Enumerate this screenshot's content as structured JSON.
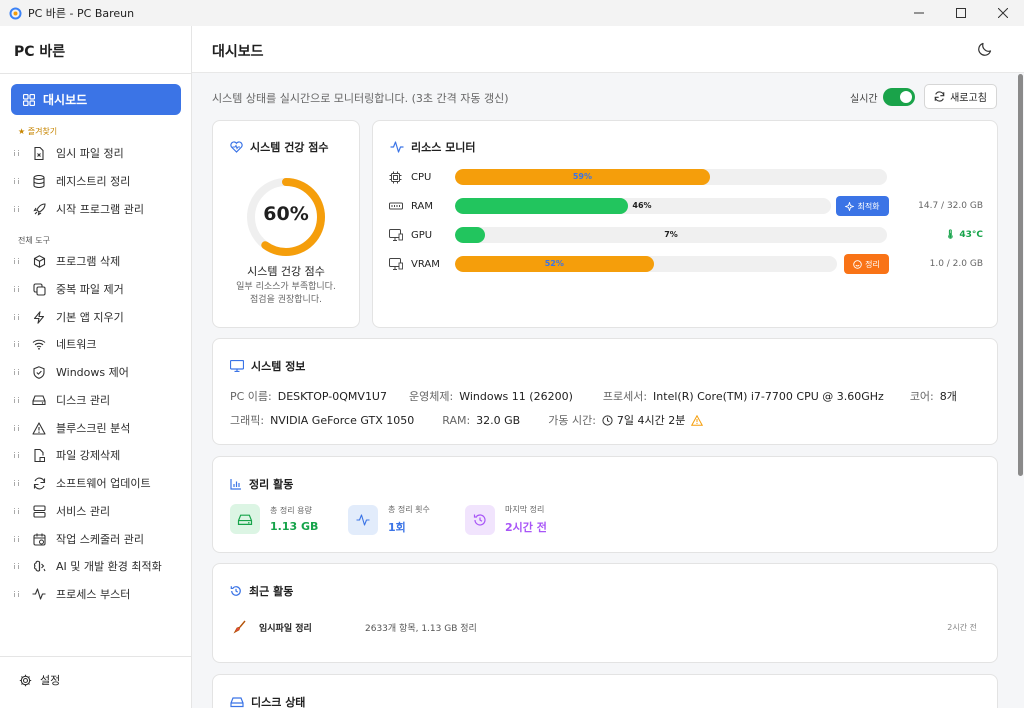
{
  "window": {
    "title": "PC 바른 - PC Bareun"
  },
  "sidebar": {
    "app_name": "PC 바른",
    "active_item": {
      "label": "대시보드",
      "icon": "grid-icon"
    },
    "favorites_label": "★ 즐겨찾기",
    "favorites": [
      {
        "label": "임시 파일 정리",
        "icon": "file-x-icon"
      },
      {
        "label": "레지스트리 정리",
        "icon": "database-icon"
      },
      {
        "label": "시작 프로그램 관리",
        "icon": "rocket-icon"
      }
    ],
    "all_tools_label": "전체 도구",
    "tools": [
      {
        "label": "프로그램 삭제",
        "icon": "package-icon"
      },
      {
        "label": "중복 파일 제거",
        "icon": "copy-icon"
      },
      {
        "label": "기본 앱 지우기",
        "icon": "lightning-icon"
      },
      {
        "label": "네트워크",
        "icon": "wifi-icon"
      },
      {
        "label": "Windows 제어",
        "icon": "shield-icon"
      },
      {
        "label": "디스크 관리",
        "icon": "drive-icon"
      },
      {
        "label": "블루스크린 분석",
        "icon": "warning-icon"
      },
      {
        "label": "파일 강제삭제",
        "icon": "file-lock-icon"
      },
      {
        "label": "소프트웨어 업데이트",
        "icon": "refresh-icon"
      },
      {
        "label": "서비스 관리",
        "icon": "server-icon"
      },
      {
        "label": "작업 스케줄러 관리",
        "icon": "calendar-icon"
      },
      {
        "label": "AI 및 개발 환경 최적화",
        "icon": "brain-icon"
      },
      {
        "label": "프로세스 부스터",
        "icon": "activity-icon"
      }
    ],
    "settings_label": "설정"
  },
  "header": {
    "title": "대시보드",
    "subtitle": "시스템 상태를 실시간으로 모니터링합니다. (3초 간격 자동 갱신)",
    "realtime_label": "실시간",
    "realtime_on": true,
    "refresh_label": "새로고침"
  },
  "health": {
    "title": "시스템 건강 점수",
    "score": 60,
    "score_text": "60%",
    "label": "시스템 건강 점수",
    "desc_line1": "일부 리소스가 부족합니다.",
    "desc_line2": "점검을 권장합니다.",
    "color": "#f59e0b"
  },
  "resources": {
    "title": "리소스 모니터",
    "rows": [
      {
        "name": "CPU",
        "percent": 59,
        "label": "59%",
        "color": "#f59e0b",
        "label_color": "#3b74e6",
        "right": "",
        "icon": "cpu-icon"
      },
      {
        "name": "RAM",
        "percent": 46,
        "label": "46%",
        "color": "#22c55e",
        "label_color": "#1f1f1f",
        "right": "14.7 / 32.0 GB",
        "icon": "memory-icon",
        "action": "최적화",
        "action_color": "#3b74e6"
      },
      {
        "name": "GPU",
        "percent": 7,
        "label": "7%",
        "color": "#22c55e",
        "label_color": "#1f1f1f",
        "right": "🌡 43°C",
        "right_color": "#16a34a",
        "icon": "monitor-icon"
      },
      {
        "name": "VRAM",
        "percent": 52,
        "label": "52%",
        "color": "#f59e0b",
        "label_color": "#3b74e6",
        "right": "1.0 / 2.0 GB",
        "icon": "monitor-icon",
        "action": "정리",
        "action_color": "#f97316"
      }
    ]
  },
  "system_info": {
    "title": "시스템 정보",
    "pc_name_k": "PC 이름:",
    "pc_name_v": "DESKTOP-0QMV1U7",
    "os_k": "운영체제:",
    "os_v": "Windows 11 (26200)",
    "cpu_k": "프로세서:",
    "cpu_v": "Intel(R) Core(TM) i7-7700 CPU @ 3.60GHz",
    "cores_k": "코어:",
    "cores_v": "8개",
    "gpu_k": "그래픽:",
    "gpu_v": "NVIDIA GeForce GTX 1050",
    "ram_k": "RAM:",
    "ram_v": "32.0 GB",
    "uptime_k": "가동 시간:",
    "uptime_v": "7일 4시간 2분"
  },
  "cleanup": {
    "title": "정리 활동",
    "total_size_k": "총 정리 용량",
    "total_size_v": "1.13 GB",
    "count_k": "총 정리 횟수",
    "count_v": "1회",
    "last_k": "마지막 정리",
    "last_v": "2시간 전",
    "colors": {
      "green": "#16a34a",
      "blue": "#3b74e6",
      "purple": "#a855f7"
    }
  },
  "recent": {
    "title": "최근 활동",
    "items": [
      {
        "name": "임시파일 정리",
        "detail": "2633개 항목, 1.13 GB 정리",
        "time": "2시간 전",
        "icon": "broom-icon"
      }
    ]
  },
  "disk": {
    "title": "디스크 상태"
  }
}
